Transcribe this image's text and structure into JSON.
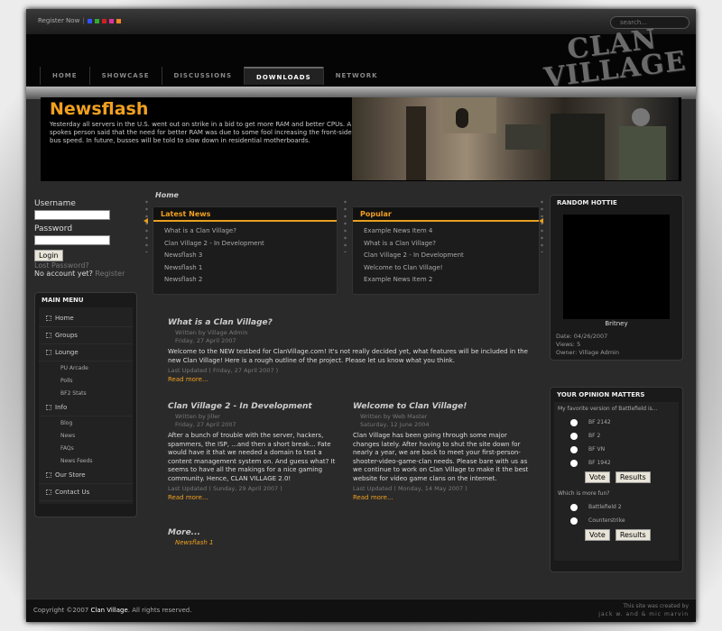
{
  "topbar": {
    "register_label": "Register Now",
    "search_placeholder": "search..."
  },
  "colors": {
    "accent": "#f0a020",
    "swatches": [
      "#3355ff",
      "#33aa33",
      "#cc2222",
      "#dd3399",
      "#ee8822"
    ]
  },
  "logo": {
    "line1": "CLAN",
    "line2": "VILLAGE"
  },
  "nav": [
    "HOME",
    "SHOWCASE",
    "DISCUSSIONS",
    "DOWNLOADS",
    "NETWORK"
  ],
  "nav_active": "DOWNLOADS",
  "newsflash": {
    "title": "Newsflash",
    "text": "Yesterday all servers in the U.S. went out on strike in a bid to get more RAM and better CPUs. A spokes person said that the need for better RAM was due to some fool increasing the front-side bus speed. In future, busses will be told to slow down in residential motherboards."
  },
  "login": {
    "username_label": "Username",
    "password_label": "Password",
    "login_button": "Login",
    "lost_password": "Lost Password?",
    "no_account": "No account yet?",
    "register": "Register"
  },
  "main_menu": {
    "title": "MAIN MENU",
    "items": [
      {
        "label": "Home",
        "sub": false
      },
      {
        "label": "Groups",
        "sub": false
      },
      {
        "label": "Lounge",
        "sub": false
      },
      {
        "label": "PU Arcade",
        "sub": true
      },
      {
        "label": "Polls",
        "sub": true
      },
      {
        "label": "BF2 Stats",
        "sub": true
      },
      {
        "label": "Info",
        "sub": false
      },
      {
        "label": "Blog",
        "sub": true
      },
      {
        "label": "News",
        "sub": true
      },
      {
        "label": "FAQs",
        "sub": true
      },
      {
        "label": "News Feeds",
        "sub": true
      },
      {
        "label": "Our Store",
        "sub": false
      },
      {
        "label": "Contact Us",
        "sub": false
      }
    ]
  },
  "breadcrumb": "Home",
  "latest_news": {
    "title": "Latest News",
    "items": [
      "What is a Clan Village?",
      "Clan Village 2 - In Development",
      "Newsflash 3",
      "Newsflash 1",
      "Newsflash 2"
    ]
  },
  "popular": {
    "title": "Popular",
    "items": [
      "Example News Item 4",
      "What is a Clan Village?",
      "Clan Village 2 - In Development",
      "Welcome to Clan Village!",
      "Example News Item 2"
    ]
  },
  "articles": {
    "main": {
      "title": "What is a Clan Village?",
      "author": "Written by Village Admin",
      "date": "Friday, 27 April 2007",
      "body": "Welcome to the NEW testbed for ClanVillage.com! It's not really decided yet, what features will be included in the new Clan Village! Here is a rough outline of the project. Please let us know what you think.",
      "updated": "Last Updated ( Friday, 27 April 2007 )",
      "read_more": "Read more..."
    },
    "left": {
      "title": "Clan Village 2 - In Development",
      "author": "Written by Jiller",
      "date": "Friday, 27 April 2007",
      "body": "After a bunch of trouble with the server, hackers, spammers, the ISP, ...and then a short break... Fate would have it that we needed a domain to test a content management system on. And guess what? It seems to have all the makings for a nice gaming community. Hence, CLAN VILLAGE 2.0!",
      "updated": "Last Updated ( Sunday, 29 April 2007 )",
      "read_more": "Read more..."
    },
    "right": {
      "title": "Welcome to Clan Village!",
      "author": "Written by Web Master",
      "date": "Saturday, 12 June 2004",
      "body": "Clan Village has been going through some major changes lately. After having to shut the site down for nearly a year, we are back to meet your first-person-shooter-video-game-clan needs. Please bare with us as we continue to work on Clan Village to make it the best website for video game clans on the internet.",
      "updated": "Last Updated ( Monday, 14 May 2007 )",
      "read_more": "Read more..."
    }
  },
  "more": {
    "label": "More...",
    "link": "Newsflash 1"
  },
  "random_hottie": {
    "title": "RANDOM HOTTIE",
    "name": "Britney",
    "date": "Date: 04/26/2007",
    "views": "Views: 5",
    "owner": "Owner: Village Admin"
  },
  "opinion": {
    "title": "YOUR OPINION MATTERS",
    "q1": "My favorite version of Battlefield is...",
    "q1_options": [
      "BF 2142",
      "BF 2",
      "BF VN",
      "BF 1942"
    ],
    "q2": "Which is more fun?",
    "q2_options": [
      "Battlefield 2",
      "Counterstrike"
    ],
    "vote": "Vote",
    "results": "Results"
  },
  "footer": {
    "copyright_pre": "Copyright ©2007",
    "brand": "Clan Village",
    "rights": ".  All rights reserved.",
    "credit1": "This site was created by",
    "credit2": "jack w. and & mic marvin"
  }
}
